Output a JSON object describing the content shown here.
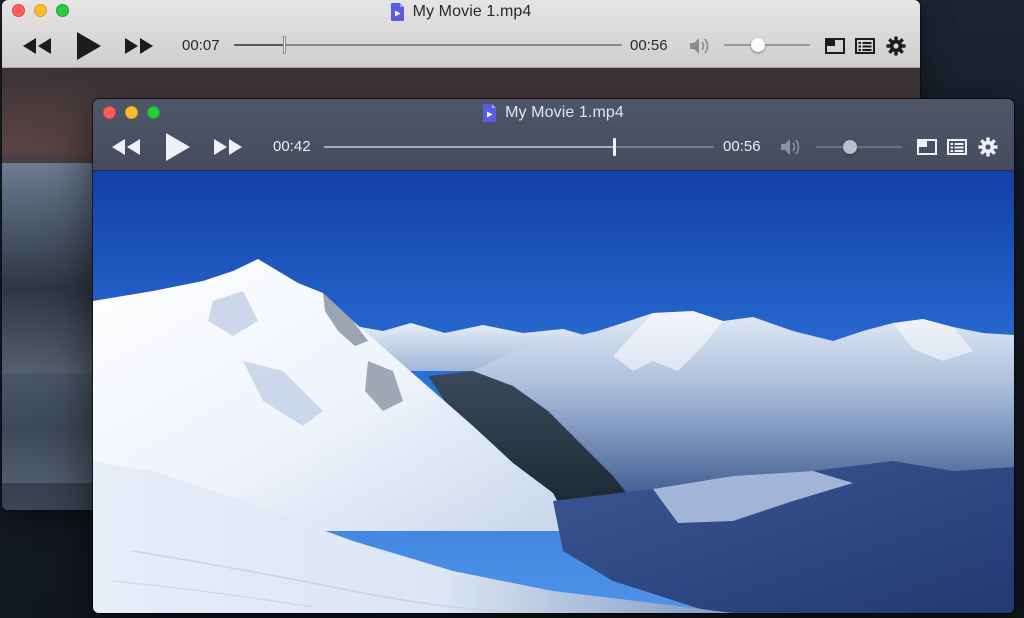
{
  "back_window": {
    "title": "My Movie 1.mp4",
    "current_time": "00:07",
    "duration": "00:56",
    "progress": 0.13,
    "volume": 0.39,
    "icons": [
      "close-button",
      "minimize-button",
      "maximize-button",
      "movie-file-icon",
      "rewind-icon",
      "play-icon",
      "fast-forward-icon",
      "volume-icon",
      "picture-in-picture-icon",
      "playlist-icon",
      "gear-icon"
    ]
  },
  "front_window": {
    "title": "My Movie 1.mp4",
    "current_time": "00:42",
    "duration": "00:56",
    "progress": 0.745,
    "volume": 0.39,
    "icons": [
      "close-button",
      "minimize-button",
      "maximize-button",
      "movie-file-icon",
      "rewind-icon",
      "play-icon",
      "fast-forward-icon",
      "volume-icon",
      "picture-in-picture-icon",
      "playlist-icon",
      "gear-icon"
    ]
  },
  "colors": {
    "accent_file_icon": "#5a5ce0",
    "traffic_close": "#fc5f57",
    "traffic_minimize": "#fdbb2e",
    "traffic_maximize": "#2ac940"
  }
}
